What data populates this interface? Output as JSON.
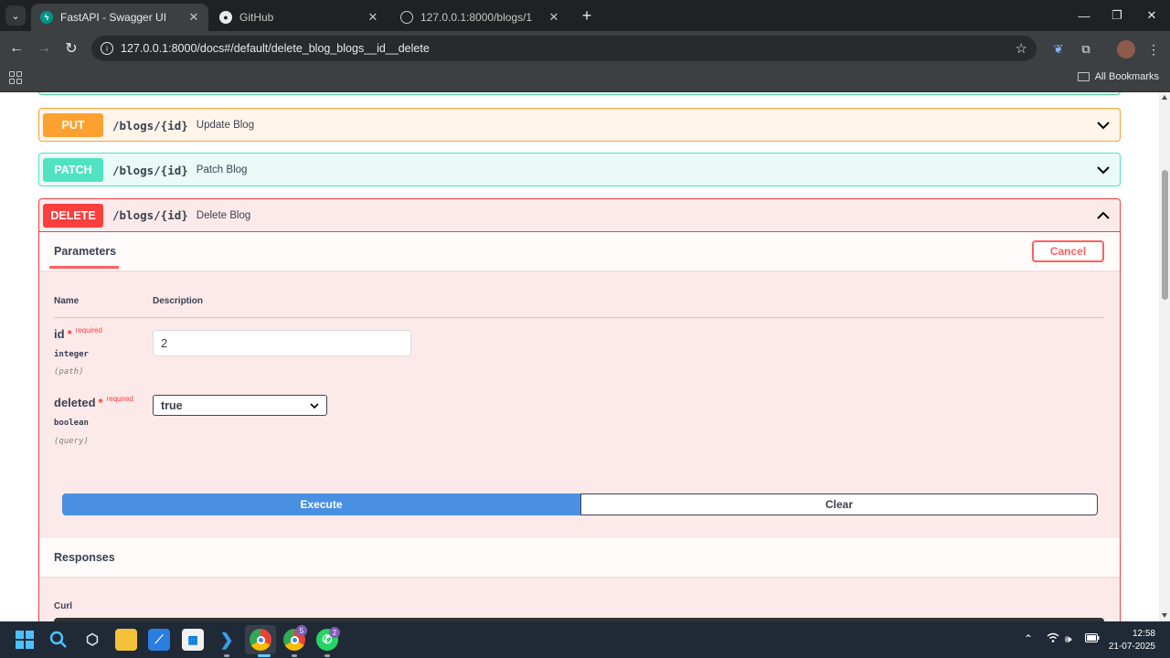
{
  "browser": {
    "tabs": [
      {
        "title": "FastAPI - Swagger UI",
        "active": true,
        "favicon": "fastapi-icon"
      },
      {
        "title": "GitHub",
        "active": false,
        "favicon": "github-icon"
      },
      {
        "title": "127.0.0.1:8000/blogs/1",
        "active": false,
        "favicon": "globe-icon"
      }
    ],
    "address": "127.0.0.1:8000/docs#/default/delete_blog_blogs__id__delete",
    "bookmarks_label": "All Bookmarks"
  },
  "operations": {
    "put": {
      "method": "PUT",
      "path": "/blogs/{id}",
      "summary": "Update Blog",
      "color": "#fca130"
    },
    "patch": {
      "method": "PATCH",
      "path": "/blogs/{id}",
      "summary": "Patch Blog",
      "color": "#50e3c2"
    },
    "delete": {
      "method": "DELETE",
      "path": "/blogs/{id}",
      "summary": "Delete Blog",
      "color": "#f93e3e"
    }
  },
  "delete_panel": {
    "parameters_tab": "Parameters",
    "cancel_label": "Cancel",
    "col_name": "Name",
    "col_description": "Description",
    "params": [
      {
        "name": "id",
        "star": "*",
        "required": "required",
        "type": "integer",
        "in": "(path)",
        "value": "2"
      },
      {
        "name": "deleted",
        "star": "*",
        "required": "required",
        "type": "boolean",
        "in": "(query)",
        "value": "true"
      }
    ],
    "execute_label": "Execute",
    "clear_label": "Clear",
    "responses_label": "Responses",
    "curl_label": "Curl"
  },
  "taskbar": {
    "time": "12:58",
    "date": "21-07-2025",
    "chrome_badge": "5",
    "whatsapp_badge": "2"
  }
}
